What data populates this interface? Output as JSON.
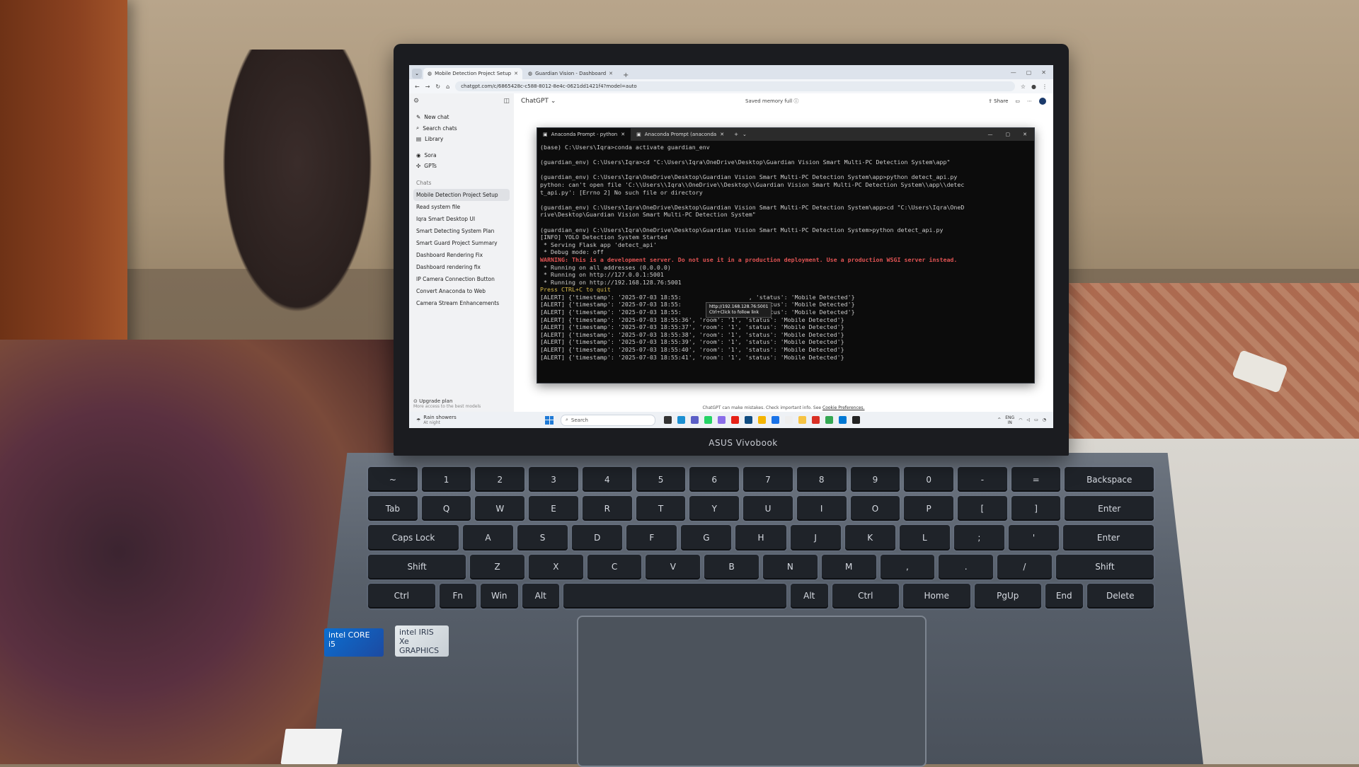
{
  "browser": {
    "tabs": [
      {
        "label": "Mobile Detection Project Setup",
        "active": true
      },
      {
        "label": "Guardian Vision - Dashboard",
        "active": false
      }
    ],
    "url": "chatgpt.com/c/6865428c-c588-8012-8e4c-0621dd1421f4?model=auto"
  },
  "chatgpt": {
    "model": "ChatGPT",
    "memory": "Saved memory full",
    "share": "Share",
    "sidebar": {
      "items": [
        {
          "label": "New chat",
          "icon": "edit-icon"
        },
        {
          "label": "Search chats",
          "icon": "search-icon"
        },
        {
          "label": "Library",
          "icon": "library-icon"
        },
        {
          "label": "Sora",
          "icon": "sora-icon"
        },
        {
          "label": "GPTs",
          "icon": "gpts-icon"
        }
      ],
      "section": "Chats",
      "chats": [
        "Mobile Detection Project Setup",
        "Read system file",
        "Iqra Smart Desktop UI",
        "Smart Detecting System Plan",
        "Smart Guard Project Summary",
        "Dashboard Rendering Fix",
        "Dashboard rendering fix",
        "IP Camera Connection Button",
        "Convert Anaconda to Web",
        "Camera Stream Enhancements"
      ],
      "upgrade": "Upgrade plan",
      "upgrade_sub": "More access to the best models"
    },
    "disclaimer": "ChatGPT can make mistakes. Check important info. See",
    "disclaimer_link": "Cookie Preferences."
  },
  "terminal": {
    "tabs": [
      "Anaconda Prompt - python",
      "Anaconda Prompt (anaconda"
    ],
    "lines": [
      {
        "text": "(base) C:\\Users\\Iqra>conda activate guardian_env",
        "style": "normal"
      },
      {
        "text": "",
        "style": "blank"
      },
      {
        "text": "(guardian_env) C:\\Users\\Iqra>cd \"C:\\Users\\Iqra\\OneDrive\\Desktop\\Guardian Vision Smart Multi-PC Detection System\\app\"",
        "style": "normal"
      },
      {
        "text": "",
        "style": "blank"
      },
      {
        "text": "(guardian_env) C:\\Users\\Iqra\\OneDrive\\Desktop\\Guardian Vision Smart Multi-PC Detection System\\app>python detect_api.py",
        "style": "normal"
      },
      {
        "text": "python: can't open file 'C:\\\\Users\\\\Iqra\\\\OneDrive\\\\Desktop\\\\Guardian Vision Smart Multi-PC Detection System\\\\app\\\\detec",
        "style": "normal"
      },
      {
        "text": "t_api.py': [Errno 2] No such file or directory",
        "style": "normal"
      },
      {
        "text": "",
        "style": "blank"
      },
      {
        "text": "(guardian_env) C:\\Users\\Iqra\\OneDrive\\Desktop\\Guardian Vision Smart Multi-PC Detection System\\app>cd \"C:\\Users\\Iqra\\OneD",
        "style": "normal"
      },
      {
        "text": "rive\\Desktop\\Guardian Vision Smart Multi-PC Detection System\"",
        "style": "normal"
      },
      {
        "text": "",
        "style": "blank"
      },
      {
        "text": "(guardian_env) C:\\Users\\Iqra\\OneDrive\\Desktop\\Guardian Vision Smart Multi-PC Detection System>python detect_api.py",
        "style": "normal"
      },
      {
        "text": "[INFO] YOLO Detection System Started",
        "style": "normal"
      },
      {
        "text": " * Serving Flask app 'detect_api'",
        "style": "normal"
      },
      {
        "text": " * Debug mode: off",
        "style": "normal"
      },
      {
        "text": "WARNING: This is a development server. Do not use it in a production deployment. Use a production WSGI server instead.",
        "style": "warn"
      },
      {
        "text": " * Running on all addresses (0.0.0.0)",
        "style": "normal"
      },
      {
        "text": " * Running on http://127.0.0.1:5001",
        "style": "normal"
      },
      {
        "text": " * Running on http://192.168.128.76:5001",
        "style": "normal"
      },
      {
        "text": "Press CTRL+C to quit",
        "style": "yellow"
      },
      {
        "text": "[ALERT] {'timestamp': '2025-07-03 18:55:                   , 'status': 'Mobile Detected'}",
        "style": "normal"
      },
      {
        "text": "[ALERT] {'timestamp': '2025-07-03 18:55:                   , 'status': 'Mobile Detected'}",
        "style": "normal"
      },
      {
        "text": "[ALERT] {'timestamp': '2025-07-03 18:55:                   , 'status': 'Mobile Detected'}",
        "style": "normal"
      },
      {
        "text": "[ALERT] {'timestamp': '2025-07-03 18:55:36', 'room': '1', 'status': 'Mobile Detected'}",
        "style": "normal"
      },
      {
        "text": "[ALERT] {'timestamp': '2025-07-03 18:55:37', 'room': '1', 'status': 'Mobile Detected'}",
        "style": "normal"
      },
      {
        "text": "[ALERT] {'timestamp': '2025-07-03 18:55:38', 'room': '1', 'status': 'Mobile Detected'}",
        "style": "normal"
      },
      {
        "text": "[ALERT] {'timestamp': '2025-07-03 18:55:39', 'room': '1', 'status': 'Mobile Detected'}",
        "style": "normal"
      },
      {
        "text": "[ALERT] {'timestamp': '2025-07-03 18:55:40', 'room': '1', 'status': 'Mobile Detected'}",
        "style": "normal"
      },
      {
        "text": "[ALERT] {'timestamp': '2025-07-03 18:55:41', 'room': '1', 'status': 'Mobile Detected'}",
        "style": "normal"
      }
    ],
    "tooltip_url": "http://192.168.128.76:5001",
    "tooltip_hint": "Ctrl+Click to follow link"
  },
  "taskbar": {
    "weather": "Rain showers",
    "weather_sub": "At night",
    "search": "Search",
    "tray_lang": "ENG",
    "tray_region": "IN"
  },
  "laptop": {
    "brand": "ASUS Vivobook",
    "sticker_core": "intel CORE i5",
    "sticker_iris": "intel IRIS Xe GRAPHICS"
  },
  "keyboard": {
    "rows": [
      [
        "~",
        "1",
        "2",
        "3",
        "4",
        "5",
        "6",
        "7",
        "8",
        "9",
        "0",
        "-",
        "=",
        "Backspace"
      ],
      [
        "Tab",
        "Q",
        "W",
        "E",
        "R",
        "T",
        "Y",
        "U",
        "I",
        "O",
        "P",
        "[",
        "]",
        "Enter"
      ],
      [
        "Caps Lock",
        "A",
        "S",
        "D",
        "F",
        "G",
        "H",
        "J",
        "K",
        "L",
        ";",
        "'",
        "Enter"
      ],
      [
        "Shift",
        "Z",
        "X",
        "C",
        "V",
        "B",
        "N",
        "M",
        ",",
        ".",
        "/",
        "Shift"
      ],
      [
        "Ctrl",
        "Fn",
        "Win",
        "Alt",
        "",
        "Alt",
        "Ctrl",
        "Home",
        "PgUp",
        "End",
        "Delete"
      ]
    ]
  },
  "colors": {
    "terminal_bg": "#0c0c0c",
    "warning": "#e05353",
    "prompt_yellow": "#d7b94a",
    "accent": "#1f7ad6"
  }
}
